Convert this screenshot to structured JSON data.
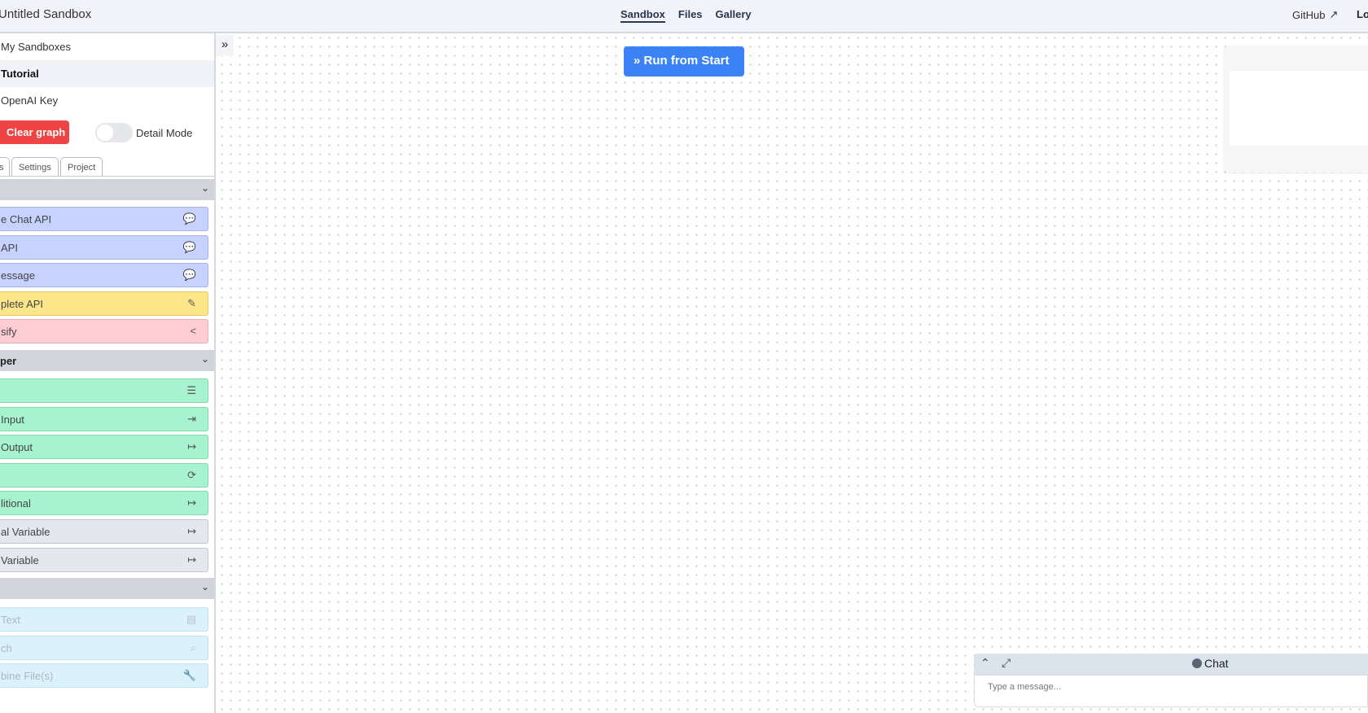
{
  "header": {
    "title": "Untitled Sandbox",
    "nav": [
      "Sandbox",
      "Files",
      "Gallery"
    ],
    "active_nav": "Sandbox",
    "github": "GitHub",
    "login": "Lo"
  },
  "sidebar": {
    "menu": [
      "My Sandboxes",
      "Tutorial",
      "OpenAI Key"
    ],
    "selected": "Tutorial",
    "clear_graph": "Clear graph",
    "detail_mode": "Detail Mode",
    "detail_mode_on": false,
    "tabs": [
      "s",
      "Settings",
      "Project"
    ],
    "sections": [
      {
        "label": "",
        "items": [
          {
            "label": "e Chat API",
            "icon": "comments-icon",
            "color": "purple"
          },
          {
            "label": " API",
            "icon": "comments-icon",
            "color": "purple"
          },
          {
            "label": "essage",
            "icon": "comment-dots-icon",
            "color": "purple"
          },
          {
            "label": "plete API",
            "icon": "pencil-icon",
            "color": "yellow"
          },
          {
            "label": "sify",
            "icon": "share-icon",
            "color": "red"
          }
        ]
      },
      {
        "label": "per",
        "items": [
          {
            "label": "",
            "icon": "align-left-icon",
            "color": "green"
          },
          {
            "label": "Input",
            "icon": "sign-in-icon",
            "color": "green"
          },
          {
            "label": "Output",
            "icon": "sign-out-icon",
            "color": "green"
          },
          {
            "label": "",
            "icon": "refresh-icon",
            "color": "green"
          },
          {
            "label": "litional",
            "icon": "sign-out-icon",
            "color": "green"
          },
          {
            "label": "al Variable",
            "icon": "sign-out-icon",
            "color": "gray"
          },
          {
            "label": "Variable",
            "icon": "sign-out-icon",
            "color": "gray"
          }
        ]
      },
      {
        "label": "",
        "items": [
          {
            "label": "Text",
            "icon": "file-icon",
            "color": "blue"
          },
          {
            "label": "ch",
            "icon": "search-icon",
            "color": "blue"
          },
          {
            "label": "bine File(s)",
            "icon": "wrench-icon",
            "color": "blue"
          }
        ]
      }
    ]
  },
  "canvas": {
    "run_button": "Run from Start"
  },
  "chat": {
    "title": "Chat",
    "placeholder": "Type a message..."
  }
}
